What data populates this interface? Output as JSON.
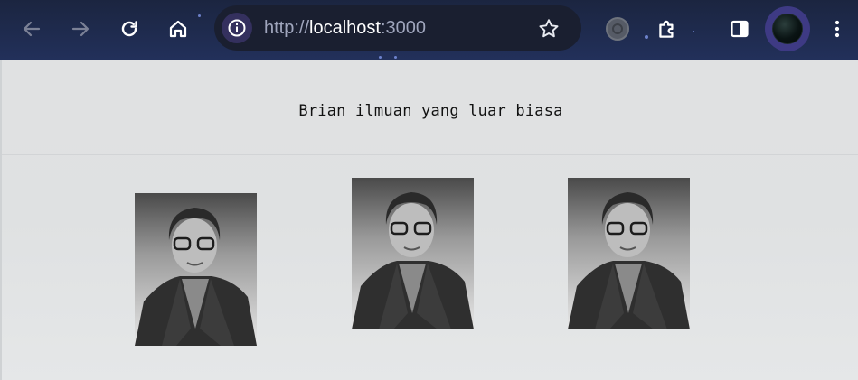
{
  "browser": {
    "url_scheme": "http://",
    "url_host": "localhost",
    "url_port": ":3000",
    "icons": {
      "back": "arrow-left-icon",
      "forward": "arrow-right-icon",
      "reload": "reload-icon",
      "home": "home-icon",
      "site_info": "info-icon",
      "bookmark": "star-icon",
      "extension": "extension-circle-icon",
      "extensions": "puzzle-icon",
      "side_panel": "side-panel-icon",
      "menu": "kebab-menu-icon"
    }
  },
  "page": {
    "heading": "Brian ilmuan yang luar biasa",
    "photos": [
      {
        "alt": "portrait-photo"
      },
      {
        "alt": "portrait-photo"
      },
      {
        "alt": "portrait-photo"
      }
    ]
  },
  "colors": {
    "toolbar_bg": "#1b2540",
    "omnibox_bg": "#1a1f30",
    "page_bg": "#e0e1e2",
    "avatar_ring": "#3e3a84"
  }
}
